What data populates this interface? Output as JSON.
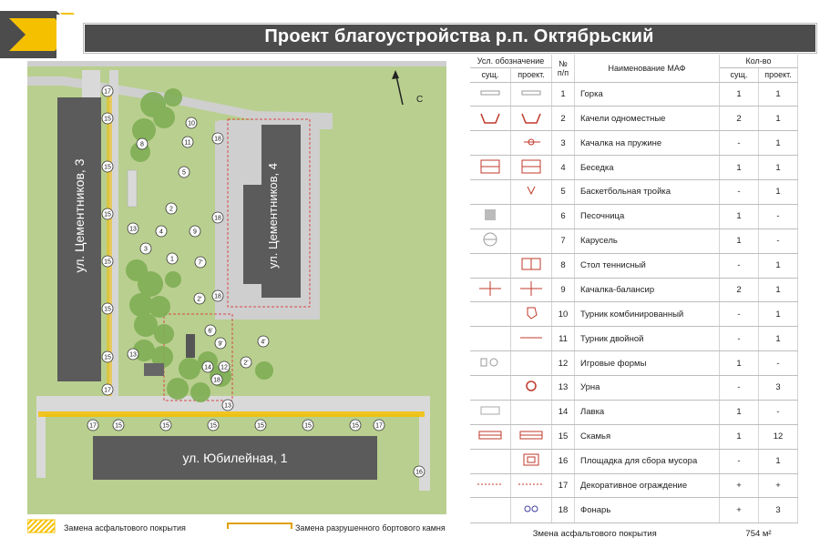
{
  "title": "Проект благоустройства р.п. Октябрьский",
  "colors": {
    "yellow": "#f5c000",
    "grass": "#b9cf8f",
    "road": "#cfcfcf",
    "building": "#5b5b5b",
    "title_bar": "#4c4c4c",
    "tree": "#7fae54"
  },
  "map": {
    "north_label": "С",
    "buildings": [
      "ул. Цементников, 3",
      "ул. Цементников, 4",
      "ул. Юбилейная, 1"
    ],
    "markers": [
      "17",
      "15",
      "15",
      "15",
      "15",
      "15",
      "15",
      "13",
      "13",
      "17",
      "8",
      "10",
      "11",
      "5",
      "2",
      "4",
      "9",
      "3",
      "1",
      "7'",
      "2'",
      "6'",
      "9'",
      "4'",
      "14",
      "12",
      "13",
      "2'",
      "18",
      "18",
      "18",
      "18",
      "17",
      "15",
      "15",
      "15",
      "15",
      "15",
      "15",
      "17",
      "16"
    ]
  },
  "legend": {
    "asphalt": "Замена асфальтового покрытия",
    "curb": "Замена разрушенного бортового камня"
  },
  "table": {
    "header": {
      "symbol": "Усл. обозначение",
      "existing": "сущ.",
      "project": "проект.",
      "number": "№\nп/п",
      "name": "Наименование МАФ",
      "qty": "Кол-во",
      "qty_existing": "сущ.",
      "qty_project": "проект."
    },
    "rows": [
      {
        "n": "1",
        "name": "Горка",
        "exist": "1",
        "proj": "1",
        "icon_e": "slide",
        "icon_p": "slide"
      },
      {
        "n": "2",
        "name": "Качели одноместные",
        "exist": "2",
        "proj": "1",
        "icon_e": "swing",
        "icon_p": "swing"
      },
      {
        "n": "3",
        "name": "Качалка на пружине",
        "exist": "-",
        "proj": "1",
        "icon_e": "",
        "icon_p": "spring"
      },
      {
        "n": "4",
        "name": "Беседка",
        "exist": "1",
        "proj": "1",
        "icon_e": "gazebo",
        "icon_p": "gazebo"
      },
      {
        "n": "5",
        "name": "Баскетбольная тройка",
        "exist": "-",
        "proj": "1",
        "icon_e": "",
        "icon_p": "basket"
      },
      {
        "n": "6",
        "name": "Песочница",
        "exist": "1",
        "proj": "-",
        "icon_e": "sandbox",
        "icon_p": ""
      },
      {
        "n": "7",
        "name": "Карусель",
        "exist": "1",
        "proj": "-",
        "icon_e": "carousel",
        "icon_p": ""
      },
      {
        "n": "8",
        "name": "Стол теннисный",
        "exist": "-",
        "proj": "1",
        "icon_e": "",
        "icon_p": "table"
      },
      {
        "n": "9",
        "name": "Качалка-балансир",
        "exist": "2",
        "proj": "1",
        "icon_e": "balancer",
        "icon_p": "balancer"
      },
      {
        "n": "10",
        "name": "Турник комбинированный",
        "exist": "-",
        "proj": "1",
        "icon_e": "",
        "icon_p": "bar"
      },
      {
        "n": "11",
        "name": "Турник двойной",
        "exist": "-",
        "proj": "1",
        "icon_e": "",
        "icon_p": "doublebar"
      },
      {
        "n": "12",
        "name": "Игровые формы",
        "exist": "1",
        "proj": "-",
        "icon_e": "forms",
        "icon_p": ""
      },
      {
        "n": "13",
        "name": "Урна",
        "exist": "-",
        "proj": "3",
        "icon_e": "",
        "icon_p": "urn"
      },
      {
        "n": "14",
        "name": "Лавка",
        "exist": "1",
        "proj": "-",
        "icon_e": "bench",
        "icon_p": ""
      },
      {
        "n": "15",
        "name": "Скамья",
        "exist": "1",
        "proj": "12",
        "icon_e": "bench2",
        "icon_p": "bench2"
      },
      {
        "n": "16",
        "name": "Площадка для сбора мусора",
        "exist": "-",
        "proj": "1",
        "icon_e": "",
        "icon_p": "trash"
      },
      {
        "n": "17",
        "name": "Декоративное ограждение",
        "exist": "+",
        "proj": "+",
        "icon_e": "fence",
        "icon_p": "fence"
      },
      {
        "n": "18",
        "name": "Фонарь",
        "exist": "+",
        "proj": "3",
        "icon_e": "",
        "icon_p": "lamp"
      }
    ],
    "footer": {
      "label": "Змена асфальтового покрытия",
      "value": "754 м²"
    }
  }
}
